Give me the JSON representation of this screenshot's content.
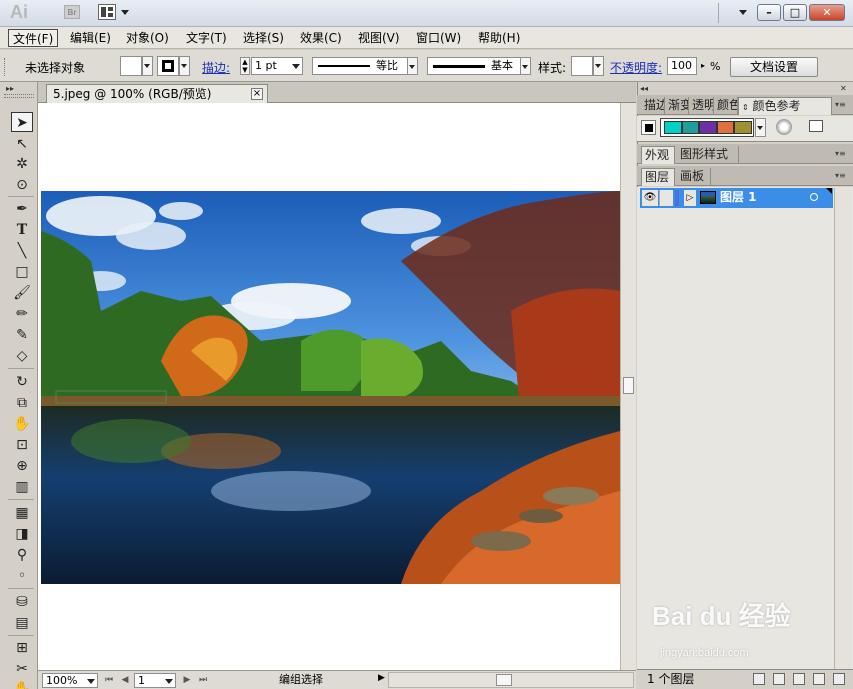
{
  "app": {
    "logo": "Ai",
    "bridge_logo": "Br"
  },
  "menu": {
    "items": [
      "文件(F)",
      "编辑(E)",
      "对象(O)",
      "文字(T)",
      "选择(S)",
      "效果(C)",
      "视图(V)",
      "窗口(W)",
      "帮助(H)"
    ]
  },
  "control": {
    "no_selection": "未选择对象",
    "stroke_label": "描边:",
    "stroke_weight": "1 pt",
    "profile": "等比",
    "brush": "基本",
    "style_label": "样式:",
    "opacity_label": "不透明度:",
    "opacity_value": "100",
    "percent": "%",
    "doc_setup": "文档设置"
  },
  "document": {
    "tab_title": "5.jpeg @ 100% (RGB/预览)",
    "close_glyph": "×"
  },
  "status": {
    "zoom": "100%",
    "artboard": "1",
    "info": "编组选择"
  },
  "panels": {
    "top_tabs": [
      "描边",
      "渐变",
      "透明",
      "颜色",
      "颜色参考"
    ],
    "swatches": [
      "#00d0c8",
      "#1f9e9b",
      "#6b2fa6",
      "#e07040",
      "#a09030"
    ],
    "appearance_tab": "外观",
    "graphic_styles_tab": "图形样式",
    "layers_tab": "图层",
    "artboards_tab": "画板",
    "layer_name": "图层 1",
    "layer_count": "1 个图层"
  },
  "watermark": {
    "brand": "Bai du 经验",
    "url": "jingyan.baidu.com"
  }
}
